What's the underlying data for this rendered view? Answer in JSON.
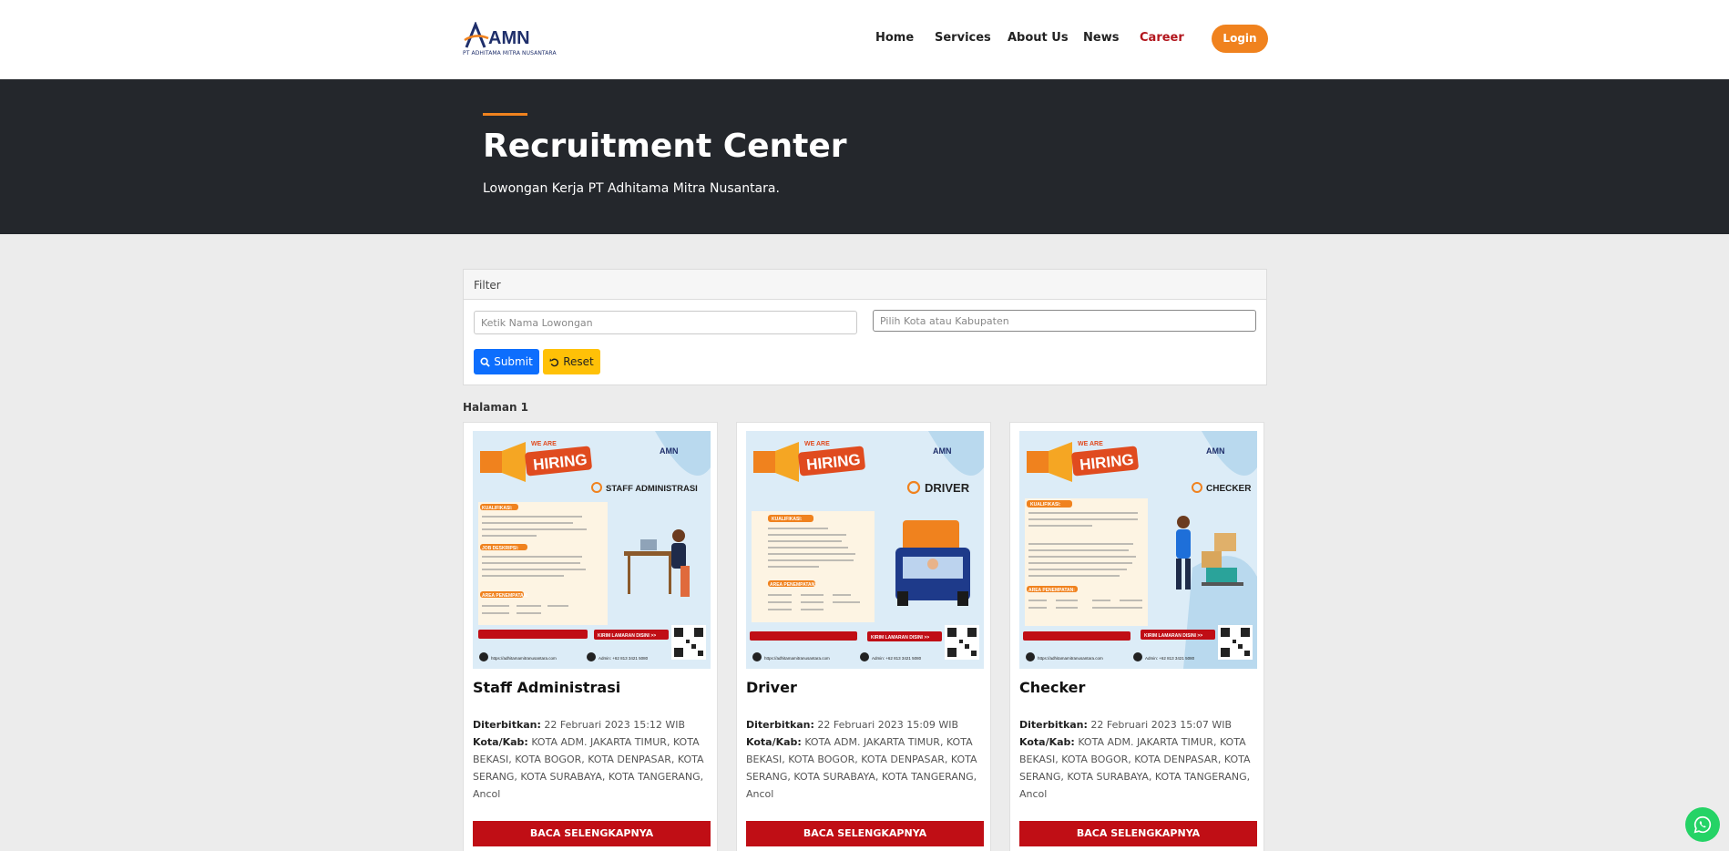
{
  "brand": {
    "logo_text": "AMN",
    "logo_sub": "PT ADHITAMA MITRA NUSANTARA"
  },
  "nav": [
    {
      "label": "Home"
    },
    {
      "label": "Services"
    },
    {
      "label": "About Us"
    },
    {
      "label": "News"
    },
    {
      "label": "Career"
    }
  ],
  "login_label": "Login",
  "hero": {
    "title": "Recruitment Center",
    "subtitle": "Lowongan Kerja PT Adhitama Mitra Nusantara."
  },
  "filter": {
    "heading": "Filter",
    "name_placeholder": "Ketik Nama Lowongan",
    "city_placeholder": "Pilih Kota atau Kabupaten",
    "submit_label": "Submit",
    "reset_label": "Reset"
  },
  "page_label": "Halaman 1",
  "labels": {
    "published": "Diterbitkan:",
    "city": "Kota/Kab:",
    "read_more": "BACA SELENGKAPNYA"
  },
  "jobs": [
    {
      "title": "Staff Administrasi",
      "poster_role": "STAFF ADMINISTRASI",
      "published": "22 Februari 2023 15:12 WIB",
      "cities": "KOTA ADM. JAKARTA TIMUR, KOTA BEKASI, KOTA BOGOR, KOTA DENPASAR, KOTA SERANG, KOTA SURABAYA, KOTA TANGERANG, Ancol"
    },
    {
      "title": "Driver",
      "poster_role": "DRIVER",
      "published": "22 Februari 2023 15:09 WIB",
      "cities": "KOTA ADM. JAKARTA TIMUR, KOTA BEKASI, KOTA BOGOR, KOTA DENPASAR, KOTA SERANG, KOTA SURABAYA, KOTA TANGERANG, Ancol"
    },
    {
      "title": "Checker",
      "poster_role": "CHECKER",
      "published": "22 Februari 2023 15:07 WIB",
      "cities": "KOTA ADM. JAKARTA TIMUR, KOTA BEKASI, KOTA BOGOR, KOTA DENPASAR, KOTA SERANG, KOTA SURABAYA, KOTA TANGERANG, Ancol"
    }
  ],
  "poster": {
    "hiring_top": "WE ARE",
    "hiring": "HIRING",
    "qualifications": "KUALIFIKASI:",
    "jobdesc": "JOB DESKRIPSI:",
    "area": "AREA PENEMPATAN:",
    "cta": "KIRIM LAMARAN DISINI >>",
    "website": "https://adhitamamitranusantara.com",
    "admin": "Admin: +62 813 3421 5080"
  },
  "icons": {
    "search": "search-icon",
    "reset": "undo-icon",
    "whatsapp": "whatsapp-icon"
  },
  "colors": {
    "accent": "#f0821e",
    "primary": "#0d6efd",
    "danger": "#c00e15",
    "warning": "#ffc107",
    "hero_bg": "#24272c"
  }
}
